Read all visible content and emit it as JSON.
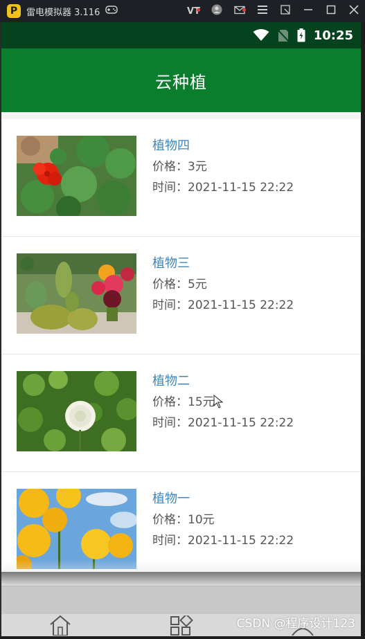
{
  "emulator": {
    "title": "雷电模拟器 3.116",
    "logo_glyph": "P",
    "vt_label": "VT",
    "icons": [
      "gamepad-icon",
      "vt-icon",
      "account-icon",
      "mail-icon",
      "menu-icon",
      "screen-icon",
      "minimize-icon",
      "maximize-icon",
      "close-icon"
    ]
  },
  "status_bar": {
    "time": "10:25",
    "icons": [
      "wifi-icon",
      "no-sim-icon",
      "battery-icon"
    ]
  },
  "app": {
    "title": "云种植",
    "header_color": "#0a7e2c"
  },
  "plants": [
    {
      "name": "植物四",
      "price": "价格：3元",
      "time": "时间：2021-11-15 22:22",
      "image": "nasturtium"
    },
    {
      "name": "植物三",
      "price": "价格：5元",
      "time": "时间：2021-11-15 22:22",
      "image": "cactus"
    },
    {
      "name": "植物二",
      "price": "价格：15元",
      "time": "时间：2021-11-15 22:22",
      "image": "clover"
    },
    {
      "name": "植物一",
      "price": "价格：10元",
      "time": "时间：2021-11-15 22:22",
      "image": "dandelion"
    }
  ],
  "bottom_nav": {
    "icons": [
      "home-icon",
      "apps-icon",
      "profile-icon"
    ]
  },
  "watermark": "CSDN @程序设计123"
}
